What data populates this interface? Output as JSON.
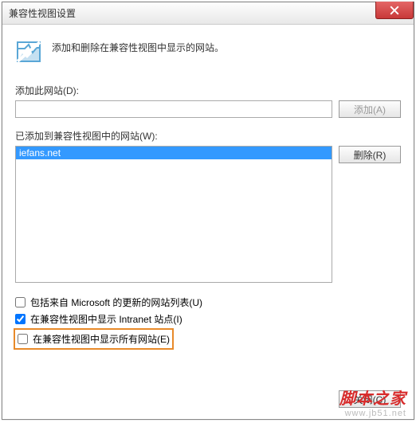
{
  "titlebar": {
    "title": "兼容性视图设置"
  },
  "header": {
    "text": "添加和删除在兼容性视图中显示的网站。"
  },
  "add": {
    "label": "添加此网站(D):",
    "value": "",
    "button": "添加(A)"
  },
  "added": {
    "label": "已添加到兼容性视图中的网站(W):",
    "items": [
      "iefans.net"
    ],
    "remove_button": "删除(R)"
  },
  "checkboxes": {
    "ms_list": {
      "label": "包括来自 Microsoft 的更新的网站列表(U)",
      "checked": false
    },
    "intranet": {
      "label": "在兼容性视图中显示 Intranet 站点(I)",
      "checked": true
    },
    "all_sites": {
      "label": "在兼容性视图中显示所有网站(E)",
      "checked": false
    }
  },
  "footer": {
    "close": "关闭(C)"
  },
  "watermark": {
    "line1": "脚本之家",
    "line2": "www.jb51.net"
  }
}
